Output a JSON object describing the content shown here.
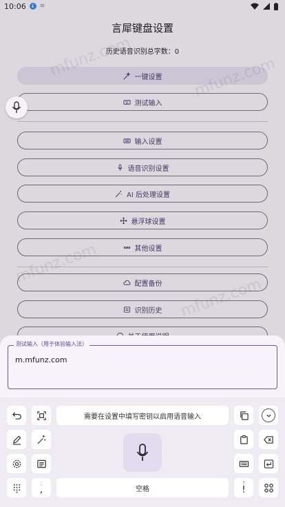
{
  "status_bar": {
    "time": "10:06"
  },
  "app": {
    "title": "言犀键盘设置",
    "total_chars": "历史语音识别总字数：0",
    "buttons": [
      {
        "label": "一键设置",
        "icon": "magic-icon"
      },
      {
        "label": "测试输入",
        "icon": "keyboard-icon"
      },
      {
        "label": "输入设置",
        "icon": "keyboard-icon"
      },
      {
        "label": "语音识别设置",
        "icon": "mic-icon"
      },
      {
        "label": "AI 后处理设置",
        "icon": "wand-icon"
      },
      {
        "label": "悬浮球设置",
        "icon": "move-icon"
      },
      {
        "label": "其他设置",
        "icon": "more-icon"
      },
      {
        "label": "配置备份",
        "icon": "cloud-icon"
      },
      {
        "label": "识别历史",
        "icon": "history-icon"
      },
      {
        "label": "关于使用说明",
        "icon": "info-icon"
      }
    ]
  },
  "test_input": {
    "label": "测试输入（用于体验输入法）",
    "value": "m.mfunz.com"
  },
  "keyboard": {
    "hint": "需要在设置中填写密钥以启用语音输入",
    "space": "空格",
    "comma_key": ",",
    "semicolon_top": ";",
    "exclaim_key": "!",
    "question_top": "?"
  },
  "watermark": "mfunz.com",
  "colors": {
    "accent": "#675a9b",
    "primary_button": "#e2dcef"
  }
}
